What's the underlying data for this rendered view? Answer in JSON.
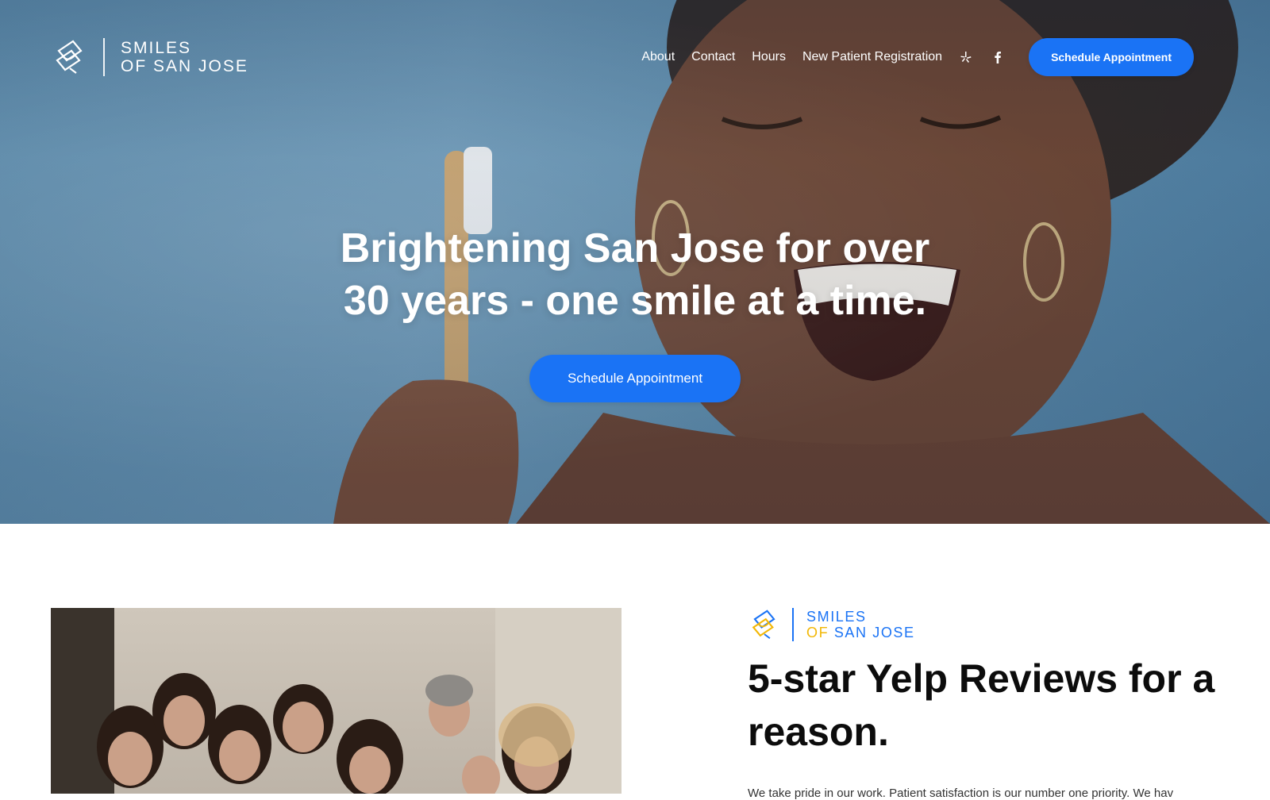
{
  "brand": {
    "line1": "SMILES",
    "line2": "OF SAN JOSE",
    "line2_of": "OF",
    "line2_rest": "SAN JOSE"
  },
  "nav": {
    "links": [
      "About",
      "Contact",
      "Hours",
      "New Patient Registration"
    ],
    "icons": [
      "yelp-icon",
      "facebook-icon"
    ],
    "cta_label": "Schedule Appointment"
  },
  "hero": {
    "title_line1": "Brightening San Jose for over",
    "title_line2": "30 years - one smile at a time.",
    "cta_label": "Schedule Appointment"
  },
  "section": {
    "title": "5-star Yelp Reviews for a reason.",
    "body": "We take pride in our work. Patient satisfaction is our number one priority. We hav"
  },
  "colors": {
    "accent": "#1a73f5",
    "accent_gold": "#f2b705",
    "heading": "#0c0c0c"
  }
}
